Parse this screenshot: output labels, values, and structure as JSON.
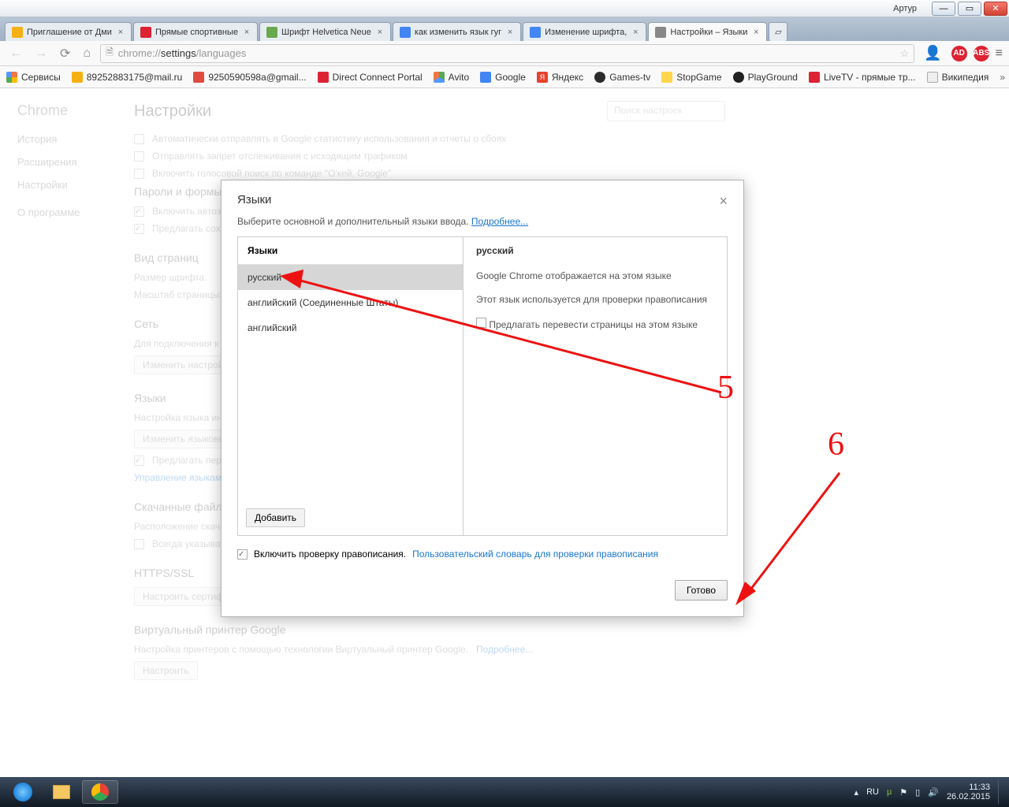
{
  "window": {
    "user": "Артур"
  },
  "tabs": [
    {
      "label": "Приглашение от Дми",
      "iconColor": "#f5b014"
    },
    {
      "label": "Прямые спортивные",
      "iconColor": "#d23"
    },
    {
      "label": "Шрифт Helvetica Neue",
      "iconColor": "#6aa84f"
    },
    {
      "label": "как изменить язык гуг",
      "iconColor": "#4285f4"
    },
    {
      "label": "Изменение шрифта, ",
      "iconColor": "#4285f4"
    },
    {
      "label": "Настройки – Языки",
      "iconColor": "#888",
      "active": true
    }
  ],
  "omnibox": {
    "prefix": "chrome://",
    "mid": "settings",
    "suffix": "/languages"
  },
  "bookmarks": [
    {
      "label": "Сервисы",
      "iconColor": "grid"
    },
    {
      "label": "89252883175@mail.ru",
      "iconColor": "#f5b014"
    },
    {
      "label": "9250590598a@gmail...",
      "iconColor": "#e04a3f"
    },
    {
      "label": "Direct Connect Portal",
      "iconColor": "#d23"
    },
    {
      "label": "Avito",
      "iconColor": "multi"
    },
    {
      "label": "Google",
      "iconColor": "#4285f4"
    },
    {
      "label": "Яндекс",
      "iconColor": "#e8412c"
    },
    {
      "label": "Games-tv",
      "iconColor": "#2b2b2b"
    },
    {
      "label": "StopGame",
      "iconColor": "#ffd54a"
    },
    {
      "label": "PlayGround",
      "iconColor": "#222"
    },
    {
      "label": "LiveTV - прямые тр...",
      "iconColor": "#d23"
    },
    {
      "label": "Википедия",
      "iconColor": "#eee"
    }
  ],
  "sidebar": {
    "brand": "Chrome",
    "items": [
      "История",
      "Расширения",
      "Настройки",
      "О программе"
    ]
  },
  "settings": {
    "title": "Настройки",
    "search_placeholder": "Поиск настроек",
    "opts": {
      "autoStats": "Автоматически отправлять в Google статистику использования и отчеты о сбоях",
      "dnt": "Отправлять запрет отслеживания с исходящим трафиком",
      "okgoogle": "Включить голосовой поиск по команде \"О'кей, Google\""
    },
    "passwords": {
      "title": "Пароли и формы",
      "autofill": "Включить автозап",
      "offerSave": "Предлагать сохра"
    },
    "view": {
      "title": "Вид страниц",
      "fontSize": "Размер шрифта:",
      "pageZoom": "Масштаб страницы:"
    },
    "network": {
      "title": "Сеть",
      "desc": "Для подключения к с",
      "btn": "Изменить настройк"
    },
    "languages": {
      "title": "Языки",
      "desc": "Настройка языка инт",
      "btn": "Изменить языковые",
      "offerTranslate": "Предлагать перев",
      "manage": "Управление языками"
    },
    "downloads": {
      "title": "Скачанные файлы",
      "loc": "Расположение скачи",
      "ask": "Всегда указывать"
    },
    "https": {
      "title": "HTTPS/SSL",
      "btn": "Настроить сертификаты..."
    },
    "printer": {
      "title": "Виртуальный принтер Google",
      "desc": "Настройка принтеров с помощью технологии Виртуальный принтер Google.",
      "more": "Подробнее...",
      "btn": "Настроить"
    }
  },
  "modal": {
    "title": "Языки",
    "subtitle": "Выберите основной и дополнительный языки ввода.",
    "subtitleLink": "Подробнее...",
    "leftHeader": "Языки",
    "langs": [
      {
        "name": "русский",
        "selected": true
      },
      {
        "name": "английский (Соединенные Штаты)"
      },
      {
        "name": "английский"
      }
    ],
    "addBtn": "Добавить",
    "right": {
      "header": "русский",
      "line1": "Google Chrome отображается на этом языке",
      "line2": "Этот язык используется для проверки правописания",
      "line3": "Предлагать перевести страницы на этом языке"
    },
    "spellcheck": "Включить проверку правописания.",
    "spellLink": "Пользовательский словарь для проверки правописания",
    "doneBtn": "Готово"
  },
  "annotations": {
    "num5": "5",
    "num6": "6"
  },
  "taskbar": {
    "lang": "RU",
    "time": "11:33",
    "date": "26.02.2015"
  }
}
